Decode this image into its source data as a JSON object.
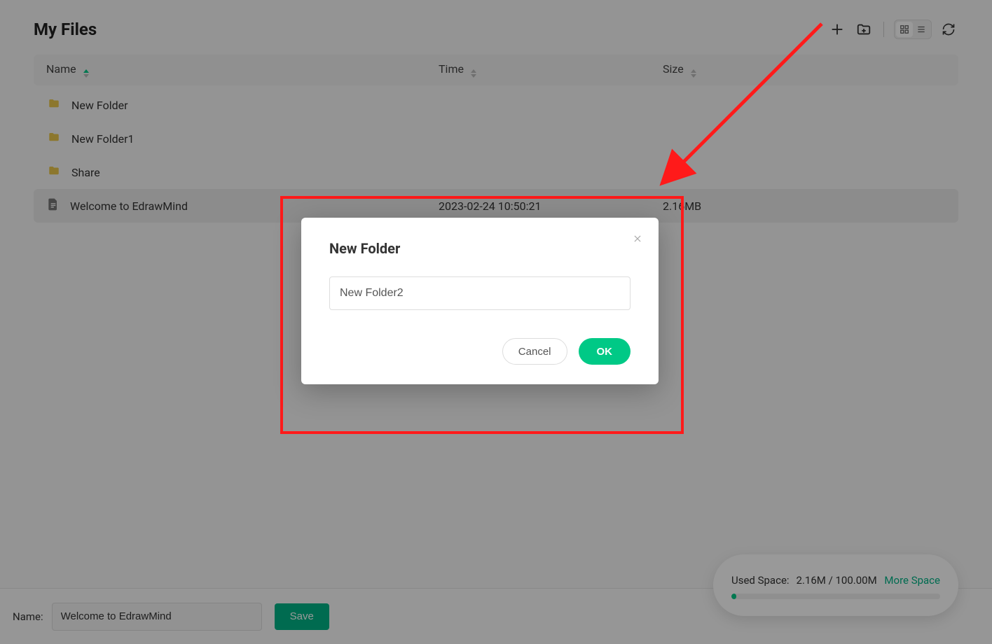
{
  "header": {
    "title": "My Files"
  },
  "columns": {
    "name": "Name",
    "time": "Time",
    "size": "Size"
  },
  "rows": [
    {
      "icon": "folder",
      "name": "New Folder",
      "time": "",
      "size": ""
    },
    {
      "icon": "folder",
      "name": "New Folder1",
      "time": "",
      "size": ""
    },
    {
      "icon": "folder",
      "name": "Share",
      "time": "",
      "size": ""
    },
    {
      "icon": "file",
      "name": "Welcome to EdrawMind",
      "time": "2023-02-24 10:50:21",
      "size": "2.16MB",
      "highlight": true
    }
  ],
  "footer": {
    "name_label": "Name:",
    "name_value": "Welcome to EdrawMind",
    "save_label": "Save"
  },
  "space": {
    "used_label": "Used Space:",
    "used_value": "2.16M / 100.00M",
    "more_label": "More Space"
  },
  "modal": {
    "title": "New Folder",
    "input_value": "New Folder2",
    "cancel": "Cancel",
    "ok": "OK"
  }
}
